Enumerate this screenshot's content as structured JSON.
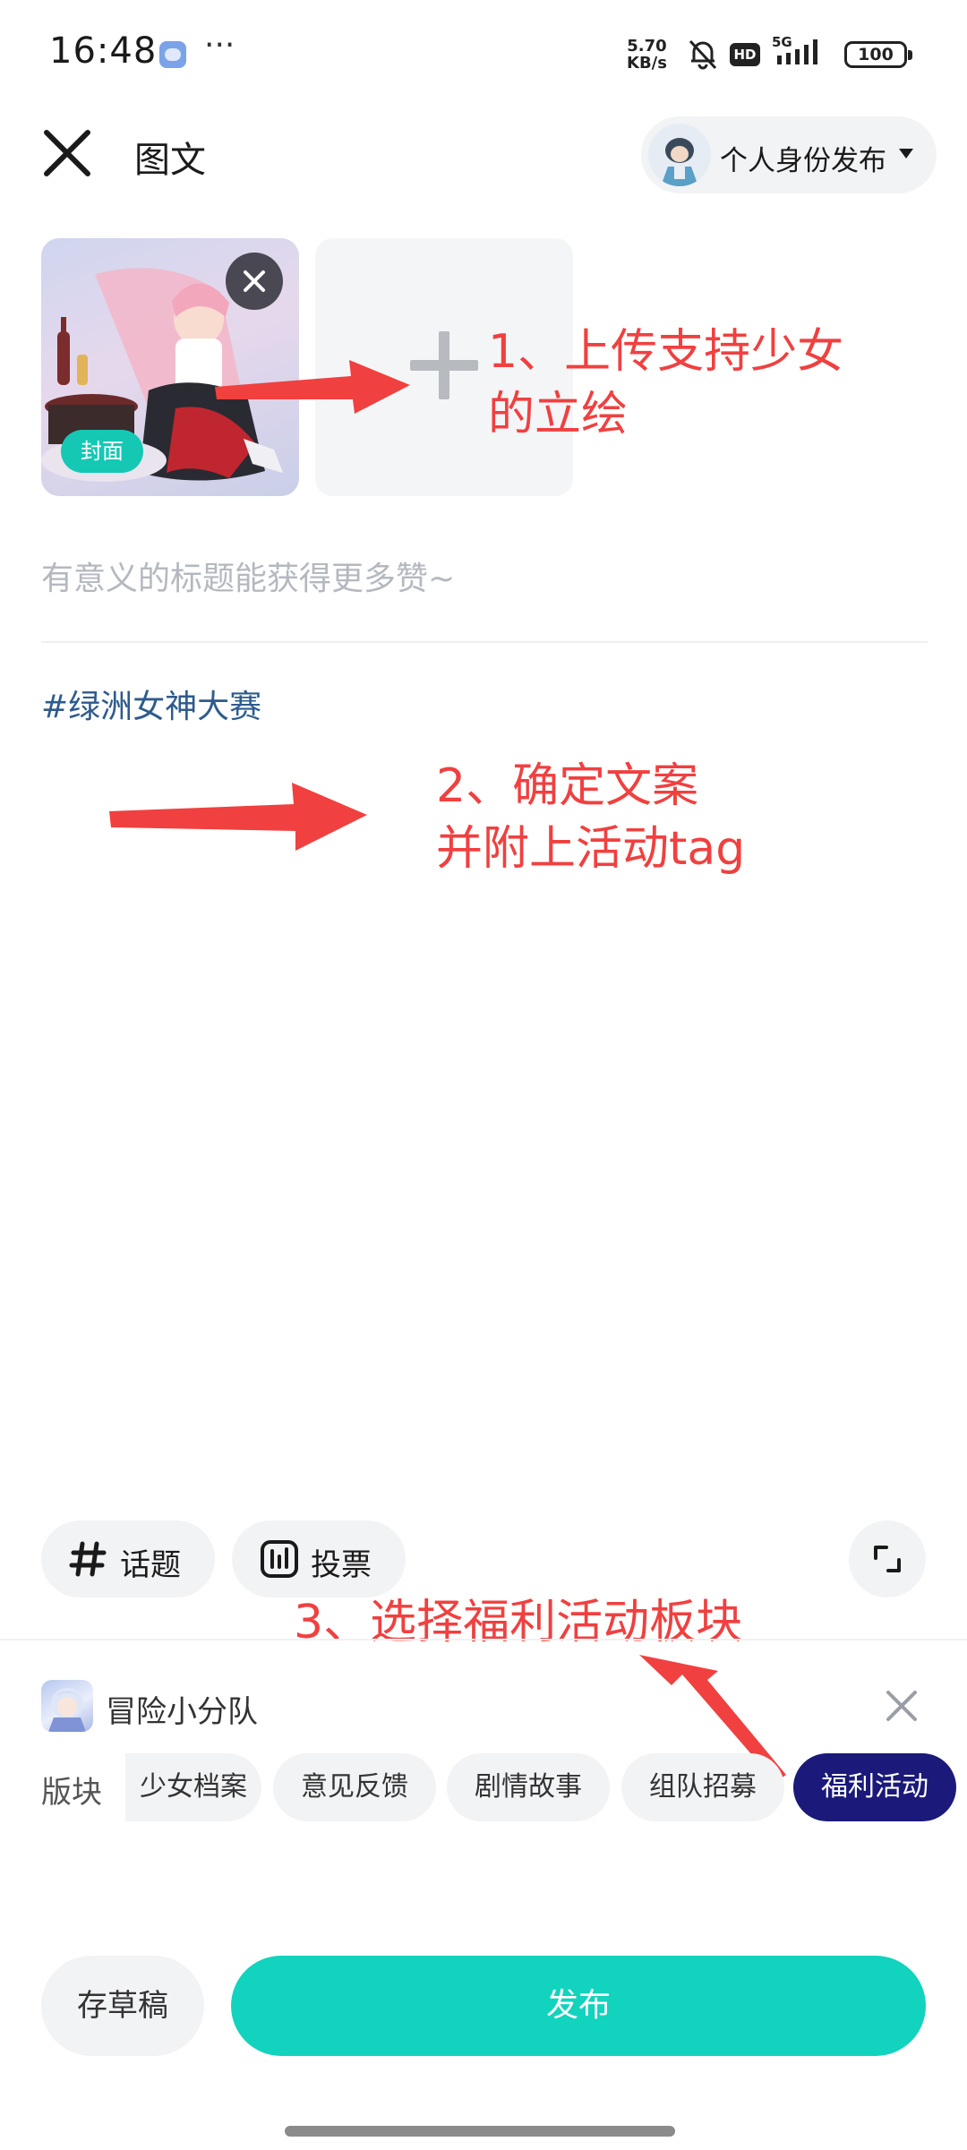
{
  "status_bar": {
    "time": "16:48",
    "more": "···",
    "net_speed_value": "5.70",
    "net_speed_unit": "KB/s",
    "hd": "HD",
    "network": "5G",
    "battery": "100"
  },
  "header": {
    "title": "图文",
    "identity_label": "个人身份发布"
  },
  "images": {
    "cover_badge": "封面"
  },
  "editor": {
    "title_placeholder": "有意义的标题能获得更多赞~",
    "topic_tag": "#绿洲女神大赛"
  },
  "annotations": {
    "step1_line1": "1、上传支持少女",
    "step1_line2": "的立绘",
    "step2_line1": "2、确定文案",
    "step2_line2": "并附上活动tag",
    "step3": "3、选择福利活动板块",
    "color": "#f04040"
  },
  "toolbar": {
    "topic_label": "话题",
    "vote_label": "投票"
  },
  "community": {
    "name": "冒险小分队"
  },
  "boards": {
    "label": "版块",
    "items": [
      "少女档案",
      "意见反馈",
      "剧情故事",
      "组队招募",
      "福利活动"
    ],
    "selected": "福利活动"
  },
  "actions": {
    "draft_label": "存草稿",
    "publish_label": "发布"
  },
  "colors": {
    "accent": "#12d3bd",
    "selected_chip": "#1b1a7a",
    "tag_text": "#2e5b8c"
  }
}
